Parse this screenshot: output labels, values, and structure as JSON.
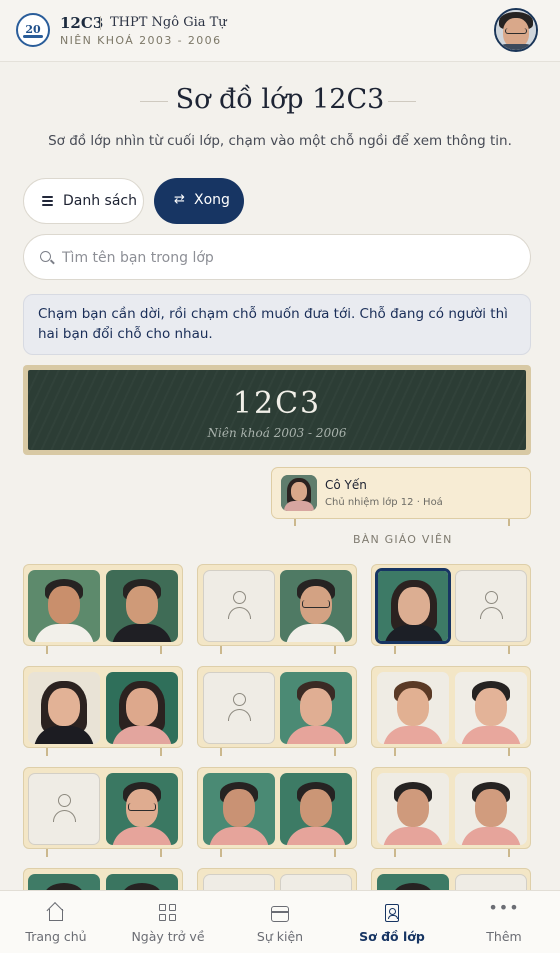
{
  "header": {
    "logo_text": "20",
    "class_name": "12C3",
    "school": "THPT Ngô Gia Tự",
    "cohort": "NIÊN KHOÁ 2003 - 2006",
    "avatar_icon": "user-avatar"
  },
  "page": {
    "title": "Sơ đồ lớp 12C3",
    "subtitle": "Sơ đồ lớp nhìn từ cuối lớp, chạm vào một chỗ ngồi để xem thông tin."
  },
  "toolbar": {
    "list_label": "Danh sách",
    "list_icon": "list-icon",
    "done_label": "Xong",
    "done_icon": "swap-icon",
    "done_glyph": "⇄"
  },
  "search": {
    "placeholder": "Tìm tên bạn trong lớp",
    "value": ""
  },
  "hint": "Chạm bạn cần dời, rồi chạm chỗ muốn đưa tới. Chỗ đang có người thì hai bạn đổi chỗ cho nhau.",
  "board": {
    "title": "12C3",
    "subtitle": "Niên khoá 2003 - 2006"
  },
  "teacher": {
    "name": "Cô Yến",
    "role": "Chủ nhiệm lớp 12 · Hoá",
    "desk_label": "BÀN GIÁO VIÊN"
  },
  "colors": {
    "accent": "#173563",
    "board": "#2c3d35",
    "desk": "#f3e6c6",
    "background": "#f3f1ec"
  },
  "seats": [
    [
      "photo",
      "photo",
      "empty",
      "photo",
      "photo-selected",
      "empty"
    ],
    [
      "photo",
      "photo",
      "empty",
      "photo",
      "photo",
      "photo"
    ],
    [
      "empty",
      "photo",
      "photo",
      "photo",
      "photo",
      "photo"
    ]
  ],
  "nav": {
    "items": [
      {
        "label": "Trang chủ",
        "icon": "home-icon"
      },
      {
        "label": "Ngày trở về",
        "icon": "grid-icon"
      },
      {
        "label": "Sự kiện",
        "icon": "calendar-icon"
      },
      {
        "label": "Sơ đồ lớp",
        "icon": "seating-chart-icon",
        "active": true
      },
      {
        "label": "Thêm",
        "icon": "more-icon"
      }
    ],
    "more_glyph": "•••"
  }
}
